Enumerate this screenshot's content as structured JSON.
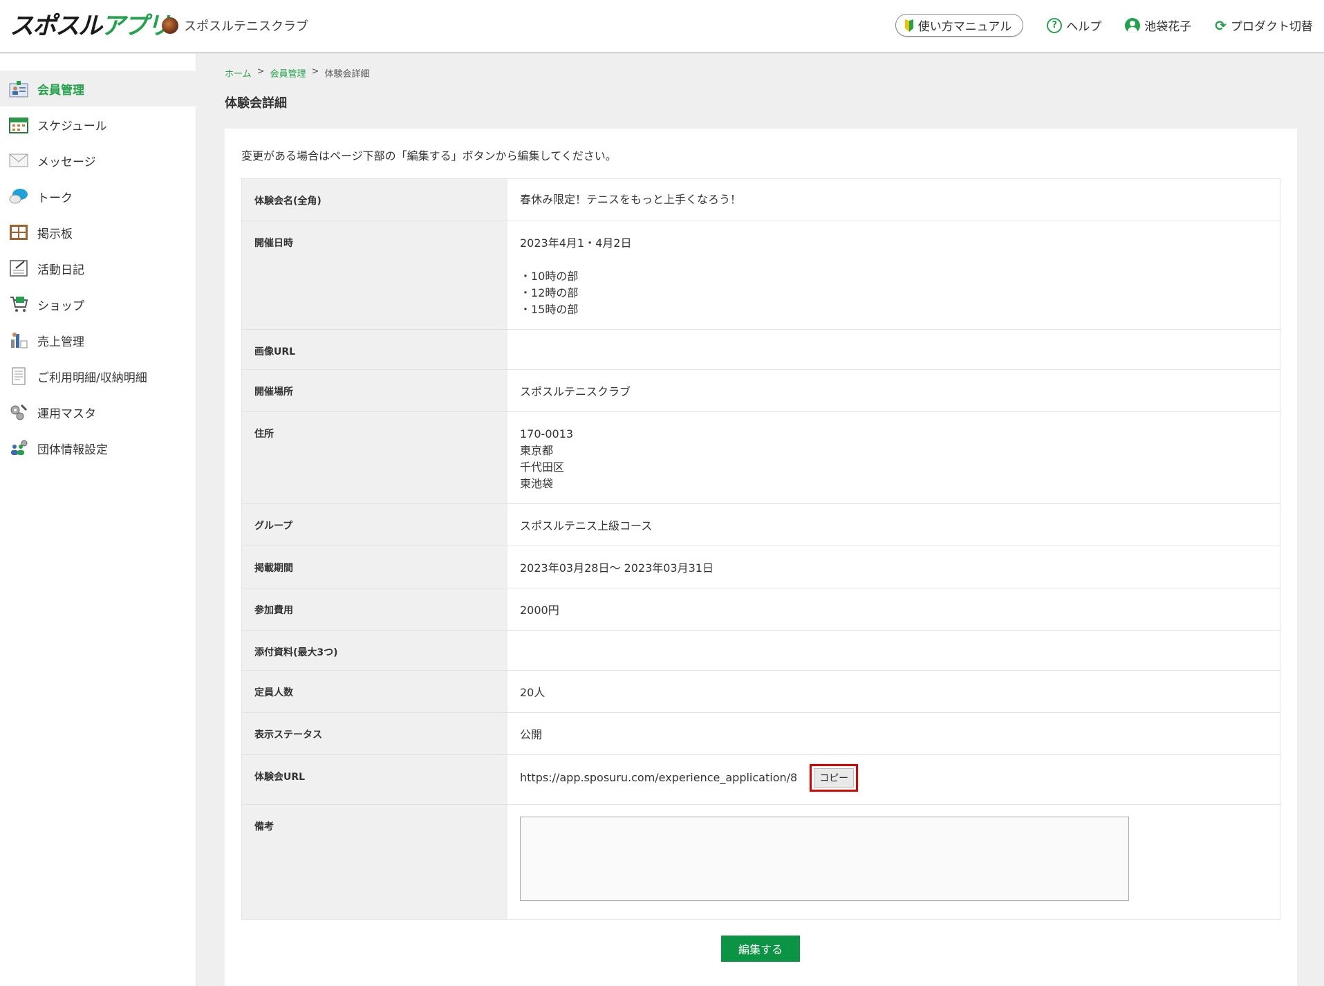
{
  "header": {
    "logo_main": "スポスル",
    "logo_accent": "アプリ",
    "club_name": "スポスルテニスクラブ",
    "manual_label": "使い方マニュアル",
    "help_label": "ヘルプ",
    "user_name": "池袋花子",
    "product_switch_label": "プロダクト切替"
  },
  "sidebar": {
    "items": [
      {
        "label": "会員管理",
        "icon": "member-icon",
        "active": true
      },
      {
        "label": "スケジュール",
        "icon": "calendar-icon",
        "active": false
      },
      {
        "label": "メッセージ",
        "icon": "envelope-icon",
        "active": false
      },
      {
        "label": "トーク",
        "icon": "chat-bubble-icon",
        "active": false
      },
      {
        "label": "掲示板",
        "icon": "bulletin-board-icon",
        "active": false
      },
      {
        "label": "活動日記",
        "icon": "diary-icon",
        "active": false
      },
      {
        "label": "ショップ",
        "icon": "shopping-cart-icon",
        "active": false
      },
      {
        "label": "売上管理",
        "icon": "sales-chart-icon",
        "active": false
      },
      {
        "label": "ご利用明細/収納明細",
        "icon": "receipt-icon",
        "active": false
      },
      {
        "label": "運用マスタ",
        "icon": "tools-icon",
        "active": false
      },
      {
        "label": "団体情報設定",
        "icon": "group-settings-icon",
        "active": false
      }
    ]
  },
  "breadcrumb": {
    "home": "ホーム",
    "sep": ">",
    "member": "会員管理",
    "current": "体験会詳細"
  },
  "page_title": "体験会詳細",
  "notice": "変更がある場合はページ下部の「編集する」ボタンから編集してください。",
  "details": {
    "name": {
      "label": "体験会名(全角)",
      "value": "春休み限定！テニスをもっと上手くなろう！"
    },
    "datetime": {
      "label": "開催日時",
      "date": "2023年4月1・4月2日",
      "sessions": [
        "・10時の部",
        "・12時の部",
        "・15時の部"
      ]
    },
    "image_url": {
      "label": "画像URL",
      "value": ""
    },
    "venue": {
      "label": "開催場所",
      "value": "スポスルテニスクラブ"
    },
    "address": {
      "label": "住所",
      "lines": [
        "170-0013",
        "東京都",
        "千代田区",
        "東池袋"
      ]
    },
    "group": {
      "label": "グループ",
      "value": "スポスルテニス上級コース"
    },
    "period": {
      "label": "掲載期間",
      "value": "2023年03月28日～ 2023年03月31日"
    },
    "fee": {
      "label": "参加費用",
      "value": "2000円"
    },
    "attachments": {
      "label": "添付資料(最大3つ)",
      "value": ""
    },
    "capacity": {
      "label": "定員人数",
      "value": "20人"
    },
    "status": {
      "label": "表示ステータス",
      "value": "公開"
    },
    "url": {
      "label": "体験会URL",
      "value": "https://app.sposuru.com/experience_application/8",
      "copy_label": "コピー"
    },
    "remarks": {
      "label": "備考",
      "value": ""
    }
  },
  "edit_button_label": "編集する",
  "colors": {
    "accent": "#22a24a",
    "button": "#0b9444",
    "highlight": "#e00000"
  }
}
